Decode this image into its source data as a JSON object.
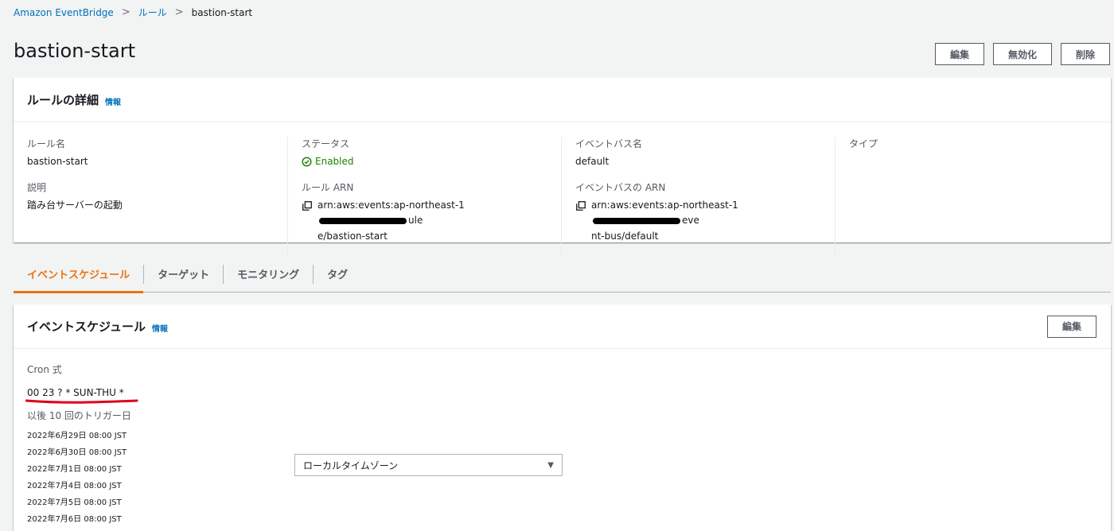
{
  "breadcrumb": {
    "root": "Amazon EventBridge",
    "rules": "ルール",
    "current": "bastion-start"
  },
  "page": {
    "title": "bastion-start",
    "actions": {
      "edit": "編集",
      "disable": "無効化",
      "delete": "削除"
    }
  },
  "details": {
    "title": "ルールの詳細",
    "info": "情報",
    "rule_name_label": "ルール名",
    "rule_name": "bastion-start",
    "description_label": "説明",
    "description": "踏み台サーバーの起動",
    "status_label": "ステータス",
    "status": "Enabled",
    "rule_arn_label": "ルール ARN",
    "rule_arn_prefix": "arn:aws:events:ap-northeast-1",
    "rule_arn_tail_1": "ule",
    "rule_arn_tail_2": "e/bastion-start",
    "bus_name_label": "イベントバス名",
    "bus_name": "default",
    "bus_arn_label": "イベントバスの ARN",
    "bus_arn_prefix": "arn:aws:events:ap-northeast-1",
    "bus_arn_tail_1": "eve",
    "bus_arn_tail_2": "nt-bus/default",
    "type_label": "タイプ"
  },
  "tabs": [
    {
      "label": "イベントスケジュール",
      "active": true
    },
    {
      "label": "ターゲット",
      "active": false
    },
    {
      "label": "モニタリング",
      "active": false
    },
    {
      "label": "タグ",
      "active": false
    }
  ],
  "schedule": {
    "title": "イベントスケジュール",
    "info": "情報",
    "edit": "編集",
    "cron_label": "Cron 式",
    "cron_expr": "00 23 ? * SUN-THU *",
    "next_triggers_label": "以後 10 回のトリガー日",
    "next_triggers": [
      "2022年6月29日 08:00 JST",
      "2022年6月30日 08:00 JST",
      "2022年7月1日 08:00 JST",
      "2022年7月4日 08:00 JST",
      "2022年7月5日 08:00 JST",
      "2022年7月6日 08:00 JST"
    ],
    "timezone_selected": "ローカルタイムゾーン"
  },
  "colors": {
    "link": "#0073bb",
    "accent": "#ec7211",
    "success": "#1d8102",
    "annotation": "#e0001b"
  }
}
